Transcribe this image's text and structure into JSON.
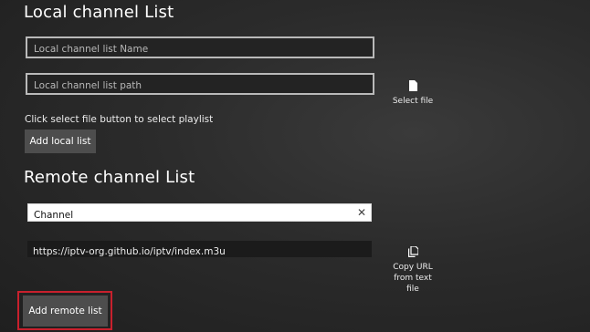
{
  "local": {
    "heading": "Local channel List",
    "name_placeholder": "Local channel list Name",
    "path_placeholder": "Local channel list path",
    "hint": "Click select file button to select playlist",
    "add_label": "Add local list",
    "select_file_label": "Select file",
    "select_file_icon": "file-icon"
  },
  "remote": {
    "heading": "Remote channel List",
    "name_value": "Channel",
    "clear_glyph": "✕",
    "url_value": "https://iptv-org.github.io/iptv/index.m3u",
    "copy_label": "Copy URL from text file",
    "copy_icon": "copy-icon",
    "add_label": "Add remote list"
  },
  "colors": {
    "highlight": "#c8202d",
    "button_bg": "#4d4d4d"
  }
}
